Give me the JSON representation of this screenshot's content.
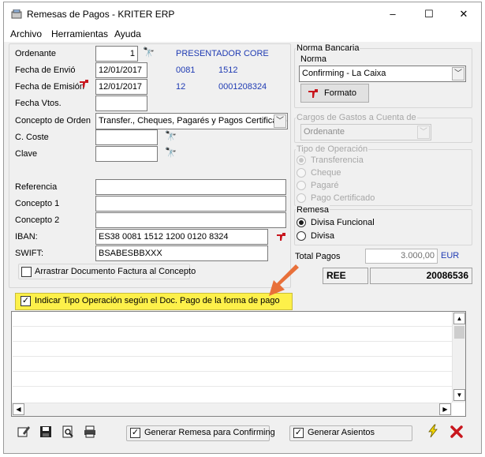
{
  "window": {
    "title": "Remesas de Pagos - KRITER ERP",
    "controls": {
      "minimize": "–",
      "maximize": "☐",
      "close": "✕"
    }
  },
  "menu": [
    "Archivo",
    "Herramientas",
    "Ayuda"
  ],
  "form": {
    "ordenante": {
      "label": "Ordenante",
      "value": "1",
      "info": "PRESENTADOR CORE"
    },
    "fecha_envio": {
      "label": "Fecha de Envió",
      "value": "12/01/2017",
      "code1": "0081",
      "code2": "1512"
    },
    "fecha_emision": {
      "label": "Fecha de Emisión",
      "value": "12/01/2017",
      "code1": "12",
      "code2": "0001208324"
    },
    "fecha_vtos": {
      "label": "Fecha Vtos.",
      "value": ""
    },
    "concepto_orden": {
      "label": "Concepto de Orden",
      "value": "Transfer., Cheques, Pagarés y Pagos Certificados"
    },
    "c_coste": {
      "label": "C. Coste",
      "value": ""
    },
    "clave": {
      "label": "Clave",
      "value": ""
    },
    "referencia": {
      "label": "Referencia",
      "value": ""
    },
    "concepto1": {
      "label": "Concepto 1",
      "value": ""
    },
    "concepto2": {
      "label": "Concepto 2",
      "value": ""
    },
    "iban": {
      "label": "IBAN:",
      "value": "ES38 0081 1512 1200 0120 8324"
    },
    "swift": {
      "label": "SWIFT:",
      "value": "BSABESBBXXX"
    },
    "arrastrar": {
      "label": "Arrastrar Documento Factura al Concepto",
      "checked": false
    },
    "indicar_tipo": {
      "label": "Indicar Tipo Operación según el Doc. Pago de la forma de pago",
      "checked": true
    }
  },
  "norma_bancaria": {
    "group_title": "Norma Bancaria",
    "norma_label": "Norma",
    "norma_value": "Confirming - La Caixa",
    "formato_button": "Formato"
  },
  "cargos": {
    "group_title": "Cargos de Gastos a Cuenta de",
    "value": "Ordenante"
  },
  "tipo_operacion": {
    "group_title": "Tipo de Operación",
    "options": [
      {
        "label": "Transferencia",
        "selected": true
      },
      {
        "label": "Cheque",
        "selected": false
      },
      {
        "label": "Pagaré",
        "selected": false
      },
      {
        "label": "Pago Certificado",
        "selected": false
      }
    ]
  },
  "remesa": {
    "group_title": "Remesa",
    "options": [
      {
        "label": "Divisa Funcional",
        "selected": true
      },
      {
        "label": "Divisa",
        "selected": false
      }
    ]
  },
  "total": {
    "label": "Total Pagos",
    "value": "3.000,00",
    "currency": "EUR"
  },
  "ree": {
    "label": "REE",
    "number": "20086536"
  },
  "bottom": {
    "generar_remesa": {
      "label": "Generar Remesa para Confirming",
      "checked": true
    },
    "generar_asientos": {
      "label": "Generar Asientos",
      "checked": true
    }
  },
  "colors": {
    "highlight": "#fdf04a",
    "arrow": "#e8703a",
    "blue_text": "#1f3bb3",
    "red_icon": "#c8161d"
  }
}
